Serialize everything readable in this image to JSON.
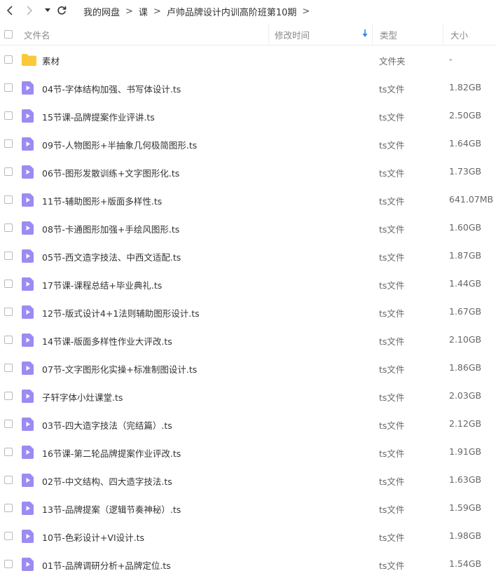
{
  "breadcrumb": [
    "我的网盘",
    "课",
    "卢帅品牌设计内训高阶班第10期"
  ],
  "breadcrumb_sep": ">",
  "header": {
    "name": "文件名",
    "modified": "修改时间",
    "type": "类型",
    "size": "大小"
  },
  "colors": {
    "accent": "#2b86f0",
    "folder": "#f9c93a",
    "video_icon": "#9b8bf3"
  },
  "files": [
    {
      "name": "素材",
      "type": "文件夹",
      "size": "-",
      "icon": "folder-icon"
    },
    {
      "name": "04节-字体结构加强、书写体设计.ts",
      "type": "ts文件",
      "size": "1.82GB",
      "icon": "video-file-icon"
    },
    {
      "name": "15节课-品牌提案作业评讲.ts",
      "type": "ts文件",
      "size": "2.50GB",
      "icon": "video-file-icon"
    },
    {
      "name": "09节-人物图形+半抽象几何极简图形.ts",
      "type": "ts文件",
      "size": "1.64GB",
      "icon": "video-file-icon"
    },
    {
      "name": "06节-图形发散训练+文字图形化.ts",
      "type": "ts文件",
      "size": "1.73GB",
      "icon": "video-file-icon"
    },
    {
      "name": "11节-辅助图形+版面多样性.ts",
      "type": "ts文件",
      "size": "641.07MB",
      "icon": "video-file-icon"
    },
    {
      "name": "08节-卡通图形加强+手绘风图形.ts",
      "type": "ts文件",
      "size": "1.60GB",
      "icon": "video-file-icon"
    },
    {
      "name": "05节-西文造字技法、中西文适配.ts",
      "type": "ts文件",
      "size": "1.87GB",
      "icon": "video-file-icon"
    },
    {
      "name": "17节课-课程总结+毕业典礼.ts",
      "type": "ts文件",
      "size": "1.44GB",
      "icon": "video-file-icon"
    },
    {
      "name": "12节-版式设计4+1法则辅助图形设计.ts",
      "type": "ts文件",
      "size": "1.67GB",
      "icon": "video-file-icon"
    },
    {
      "name": "14节课-版面多样性作业大评改.ts",
      "type": "ts文件",
      "size": "2.10GB",
      "icon": "video-file-icon"
    },
    {
      "name": "07节-文字图形化实操+标准制图设计.ts",
      "type": "ts文件",
      "size": "1.86GB",
      "icon": "video-file-icon"
    },
    {
      "name": "子轩字体小灶课堂.ts",
      "type": "ts文件",
      "size": "2.03GB",
      "icon": "video-file-icon"
    },
    {
      "name": "03节-四大造字技法（完结篇）.ts",
      "type": "ts文件",
      "size": "2.12GB",
      "icon": "video-file-icon"
    },
    {
      "name": "16节课-第二轮品牌提案作业评改.ts",
      "type": "ts文件",
      "size": "1.91GB",
      "icon": "video-file-icon"
    },
    {
      "name": "02节-中文结构、四大造字技法.ts",
      "type": "ts文件",
      "size": "1.63GB",
      "icon": "video-file-icon"
    },
    {
      "name": "13节-品牌提案（逻辑节奏神秘）.ts",
      "type": "ts文件",
      "size": "1.59GB",
      "icon": "video-file-icon"
    },
    {
      "name": "10节-色彩设计+VI设计.ts",
      "type": "ts文件",
      "size": "1.98GB",
      "icon": "video-file-icon"
    },
    {
      "name": "01节-品牌调研分析+品牌定位.ts",
      "type": "ts文件",
      "size": "1.54GB",
      "icon": "video-file-icon"
    }
  ]
}
